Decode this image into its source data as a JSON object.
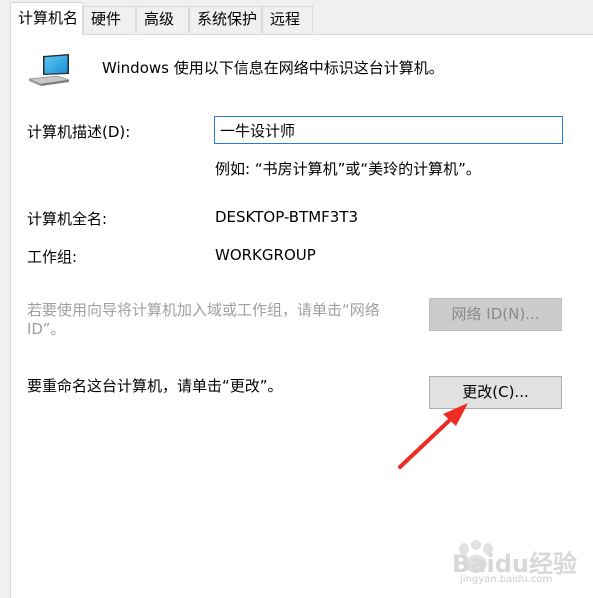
{
  "tabs": [
    {
      "label": "计算机名",
      "active": true
    },
    {
      "label": "硬件",
      "active": false
    },
    {
      "label": "高级",
      "active": false
    },
    {
      "label": "系统保护",
      "active": false
    },
    {
      "label": "远程",
      "active": false
    }
  ],
  "intro": "Windows 使用以下信息在网络中标识这台计算机。",
  "description": {
    "label": "计算机描述(D):",
    "value": "一牛设计师",
    "example": "例如: “书房计算机”或“美玲的计算机”。"
  },
  "full_name": {
    "label": "计算机全名:",
    "value": "DESKTOP-BTMF3T3"
  },
  "workgroup": {
    "label": "工作组:",
    "value": "WORKGROUP"
  },
  "network_id": {
    "text_line1": "若要使用向导将计算机加入域或工作组，请单击“网络",
    "text_line2": "ID”。",
    "button": "网络 ID(N)..."
  },
  "rename": {
    "text": "要重命名这台计算机，请单击“更改”。",
    "button": "更改(C)..."
  },
  "annotation": {
    "arrow_color": "#ee2b24"
  },
  "watermark": {
    "brand": "Baidu经验",
    "url": "jingyan.baidu.com"
  }
}
